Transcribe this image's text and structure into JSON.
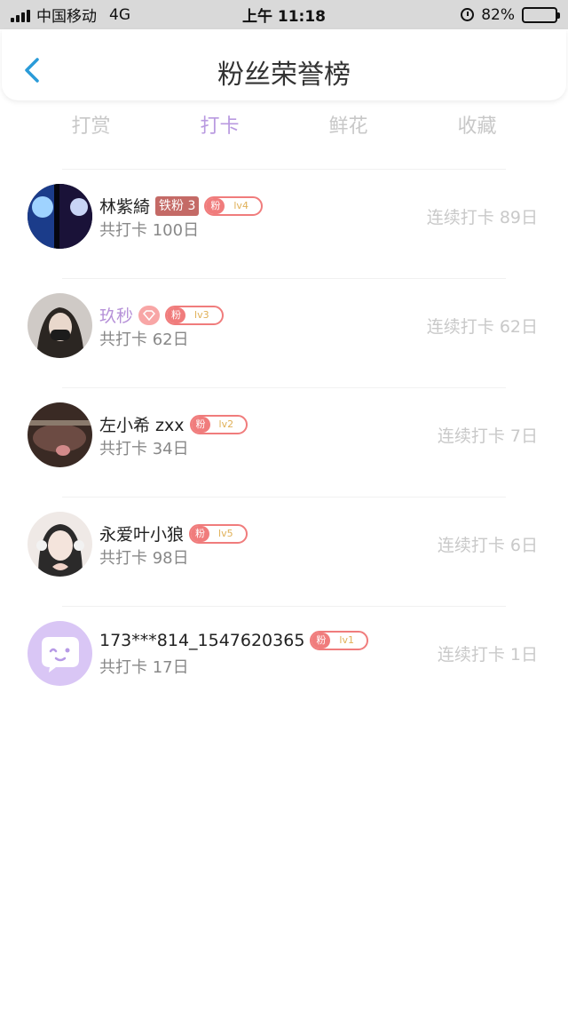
{
  "status_bar": {
    "carrier": "中国移动",
    "network": "4G",
    "time": "上午 11:18",
    "battery": "82%",
    "battery_level": 0.82
  },
  "header": {
    "title": "粉丝荣誉榜"
  },
  "tabs": [
    {
      "label": "打赏",
      "active": false
    },
    {
      "label": "打卡",
      "active": true
    },
    {
      "label": "鲜花",
      "active": false
    },
    {
      "label": "收藏",
      "active": false
    }
  ],
  "colors": {
    "accent": "#b99ae0",
    "badge": "#f07c7c",
    "iron_tag": "#c46a66"
  },
  "fan_badge_label": "粉",
  "fans": [
    {
      "name": "林紫綺",
      "special_tag": "铁粉 3",
      "level": "lv4",
      "total": "共打卡 100日",
      "streak": "连续打卡 89日"
    },
    {
      "name": "玖秒",
      "heart_tag": true,
      "level": "lv3",
      "total": "共打卡 62日",
      "streak": "连续打卡 62日"
    },
    {
      "name": "左小希 zxx",
      "level": "lv2",
      "total": "共打卡 34日",
      "streak": "连续打卡 7日"
    },
    {
      "name": "永爱叶小狼",
      "level": "lv5",
      "total": "共打卡 98日",
      "streak": "连续打卡 6日"
    },
    {
      "name": "173***814_1547620365",
      "level": "lv1",
      "total": "共打卡 17日",
      "streak": "连续打卡 1日"
    }
  ]
}
